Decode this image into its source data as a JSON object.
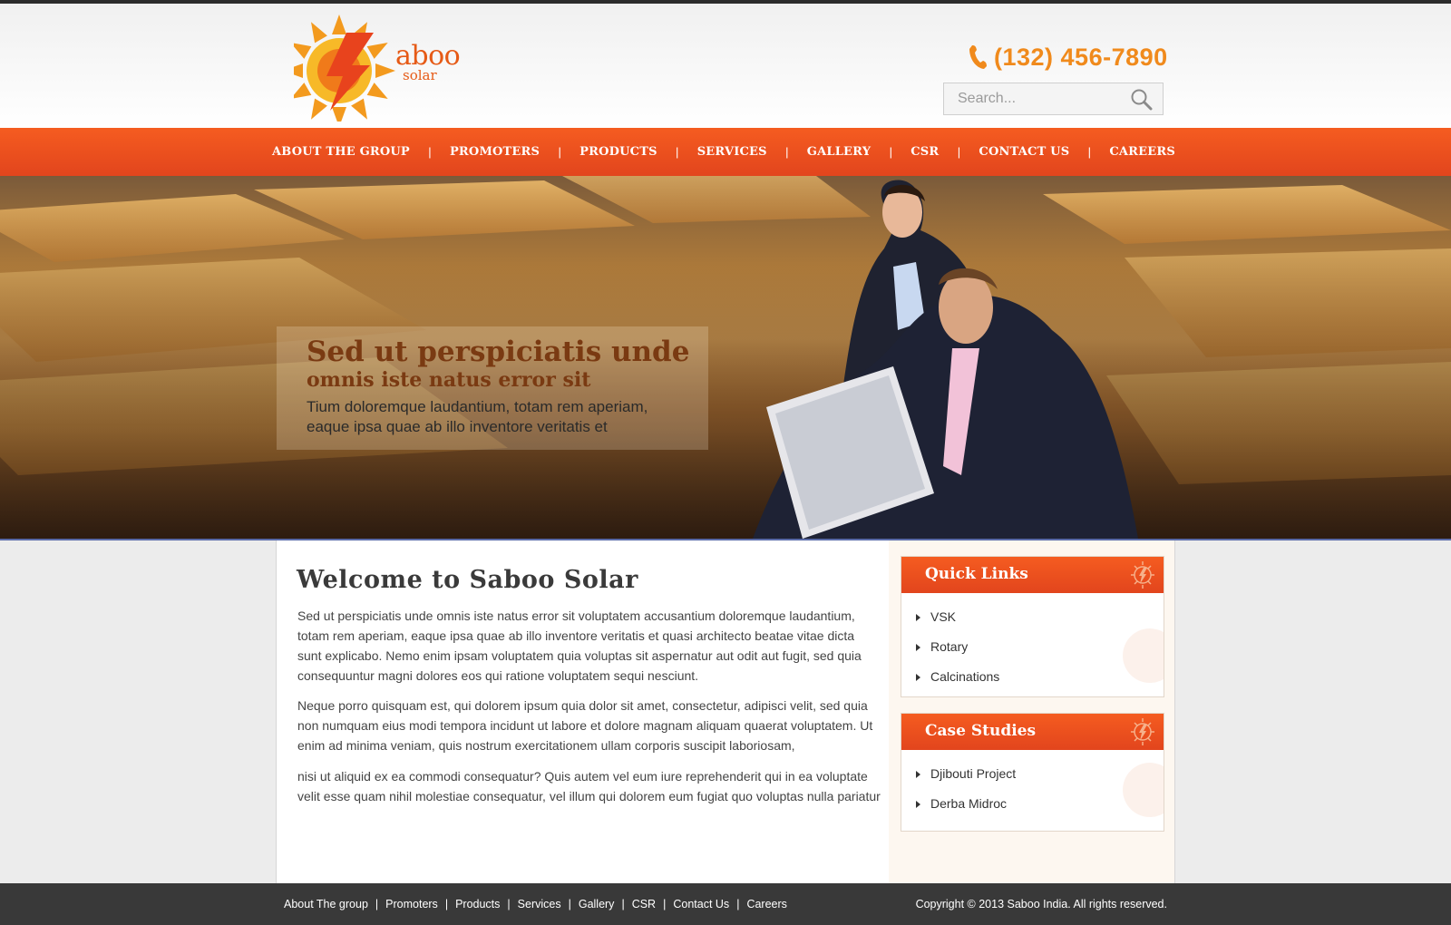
{
  "brand": {
    "name_main": "aboo",
    "name_sub": "solar",
    "colors": {
      "orange": "#e2451d",
      "accent": "#f08a1c"
    }
  },
  "header": {
    "phone": "(132) 456-7890",
    "search_placeholder": "Search...",
    "phone_icon": "phone-icon",
    "search_icon": "search-icon"
  },
  "nav": {
    "items": [
      {
        "label": "ABOUT THE GROUP"
      },
      {
        "label": "PROMOTERS"
      },
      {
        "label": "PRODUCTS"
      },
      {
        "label": "SERVICES"
      },
      {
        "label": "GALLERY"
      },
      {
        "label": "CSR"
      },
      {
        "label": "CONTACT US"
      },
      {
        "label": "CAREERS"
      }
    ],
    "separator": "|"
  },
  "hero": {
    "title": "Sed ut perspiciatis unde",
    "subtitle": "omnis iste natus error sit",
    "body": "Tium doloremque laudantium, totam rem aperiam, eaque ipsa quae ab illo inventore veritatis et"
  },
  "main": {
    "title": "Welcome to Saboo Solar",
    "paragraphs": [
      "Sed ut perspiciatis unde omnis iste natus error sit voluptatem accusantium doloremque laudantium, totam rem aperiam, eaque ipsa quae ab illo inventore veritatis et quasi architecto beatae vitae dicta sunt explicabo. Nemo enim ipsam voluptatem quia voluptas sit aspernatur aut odit aut fugit, sed quia consequuntur magni dolores eos qui ratione voluptatem sequi nesciunt.",
      "Neque porro quisquam est, qui dolorem ipsum quia dolor sit amet, consectetur, adipisci velit, sed quia non numquam eius modi tempora incidunt ut labore et dolore magnam aliquam quaerat voluptatem. Ut enim ad minima veniam, quis nostrum exercitationem ullam corporis suscipit laboriosam,",
      "nisi ut aliquid ex ea commodi consequatur? Quis autem vel eum iure reprehenderit qui in ea voluptate velit esse quam nihil molestiae consequatur, vel illum qui dolorem eum fugiat quo voluptas nulla pariatur"
    ]
  },
  "sidebar": {
    "quick_links": {
      "title": "Quick Links",
      "items": [
        {
          "label": "VSK"
        },
        {
          "label": "Rotary"
        },
        {
          "label": "Calcinations"
        }
      ]
    },
    "case_studies": {
      "title": "Case Studies",
      "items": [
        {
          "label": "Djibouti Project"
        },
        {
          "label": "Derba Midroc"
        }
      ]
    }
  },
  "footer": {
    "links": [
      {
        "label": "About The group"
      },
      {
        "label": "Promoters"
      },
      {
        "label": "Products"
      },
      {
        "label": "Services"
      },
      {
        "label": "Gallery"
      },
      {
        "label": "CSR"
      },
      {
        "label": "Contact Us"
      },
      {
        "label": "Careers"
      }
    ],
    "copyright": "Copyright © 2013 Saboo India. All rights reserved."
  }
}
